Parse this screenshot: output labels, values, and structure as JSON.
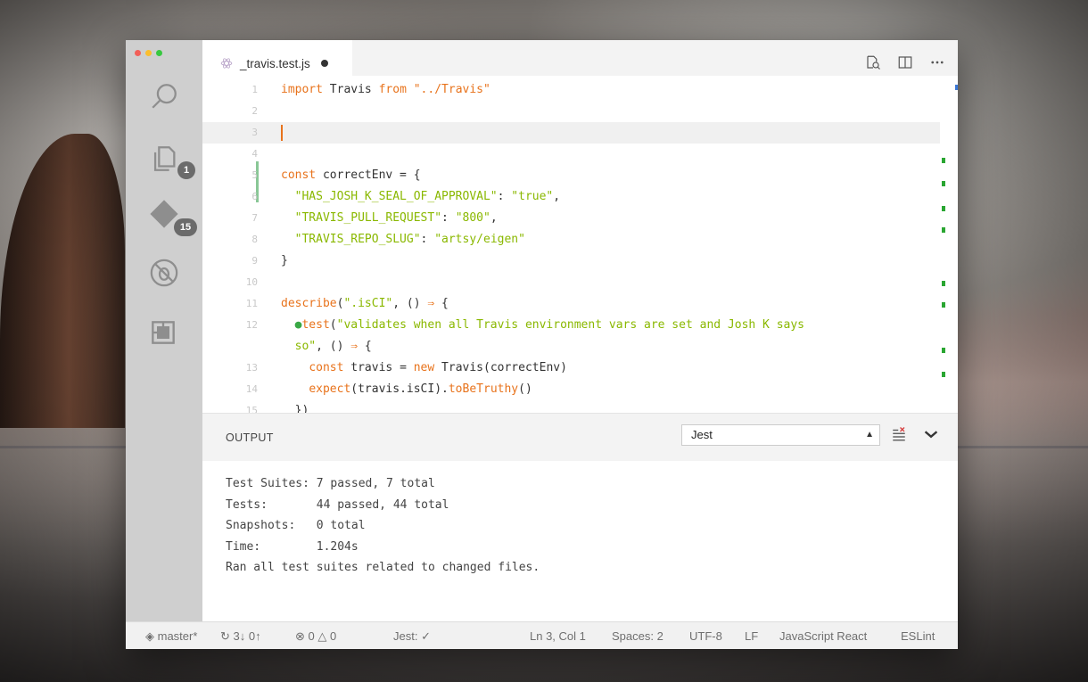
{
  "tab": {
    "filename": "_travis.test.js",
    "dirty": true
  },
  "activity": {
    "explorer_badge": "1",
    "scm_badge": "15"
  },
  "editor": {
    "lines": [
      {
        "n": "1",
        "html": "<span class=\"kw\">import</span> Travis <span class=\"kw\">from</span> <span class=\"kw\">\"../Travis\"</span>"
      },
      {
        "n": "2",
        "html": ""
      },
      {
        "n": "3",
        "html": "<span class=\"cursor\"></span>"
      },
      {
        "n": "4",
        "html": ""
      },
      {
        "n": "5",
        "html": "<span class=\"kw\">const</span> correctEnv = {"
      },
      {
        "n": "6",
        "html": "  <span class=\"str\">\"HAS_JOSH_K_SEAL_OF_APPROVAL\"</span>: <span class=\"str\">\"true\"</span>,"
      },
      {
        "n": "7",
        "html": "  <span class=\"str\">\"TRAVIS_PULL_REQUEST\"</span>: <span class=\"str\">\"800\"</span>,"
      },
      {
        "n": "8",
        "html": "  <span class=\"str\">\"TRAVIS_REPO_SLUG\"</span>: <span class=\"str\">\"artsy/eigen\"</span>"
      },
      {
        "n": "9",
        "html": "}"
      },
      {
        "n": "10",
        "html": ""
      },
      {
        "n": "11",
        "html": "<span class=\"fn\">describe</span>(<span class=\"str\">\".isCI\"</span>, () <span class=\"kw\">⇒</span> {"
      },
      {
        "n": "12",
        "html": "  <span class=\"dot\">●</span><span class=\"fn\">test</span>(<span class=\"str\">\"validates when all Travis environment vars are set and Josh K says</span>"
      },
      {
        "n": "",
        "html": "  <span class=\"str\">so\"</span>, () <span class=\"kw\">⇒</span> {"
      },
      {
        "n": "13",
        "html": "    <span class=\"kw\">const</span> travis = <span class=\"kw\">new</span> Travis(correctEnv)"
      },
      {
        "n": "14",
        "html": "    <span class=\"fn\">expect</span>(travis.isCI).<span class=\"fn\">toBeTruthy</span>()"
      },
      {
        "n": "15",
        "html": "  })"
      }
    ]
  },
  "panel": {
    "title": "OUTPUT",
    "selected_channel": "Jest",
    "output_lines": [
      "Test Suites: 7 passed, 7 total",
      "Tests:       44 passed, 44 total",
      "Snapshots:   0 total",
      "Time:        1.204s",
      "Ran all test suites related to changed files."
    ]
  },
  "status": {
    "branch": "master*",
    "sync": "3↓ 0↑",
    "errors": "0",
    "warnings": "0",
    "jest": "Jest: ✓",
    "position": "Ln 3, Col 1",
    "spaces": "Spaces: 2",
    "encoding": "UTF-8",
    "eol": "LF",
    "language": "JavaScript React",
    "linter": "ESLint"
  }
}
